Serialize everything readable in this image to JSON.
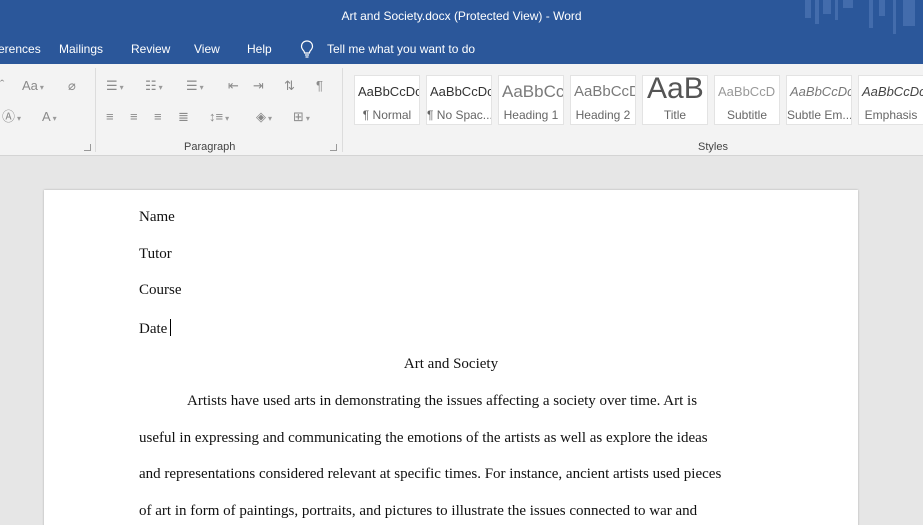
{
  "titlebar": {
    "title": "Art and Society.docx (Protected View)  -  Word"
  },
  "menu": {
    "items": [
      "erences",
      "Mailings",
      "Review",
      "View",
      "Help"
    ],
    "tell_me": "Tell me what you want to do"
  },
  "ribbon": {
    "groups": {
      "paragraph": "Paragraph",
      "styles": "Styles"
    },
    "font_icons": {
      "size_case": "Aa",
      "font_color": "A"
    },
    "styles": [
      {
        "preview": "AaBbCcDc",
        "name": "¶ Normal"
      },
      {
        "preview": "AaBbCcDc",
        "name": "¶ No Spac..."
      },
      {
        "preview": "AaBbCc",
        "name": "Heading 1"
      },
      {
        "preview": "AaBbCcD",
        "name": "Heading 2"
      },
      {
        "preview": "AaB",
        "name": "Title"
      },
      {
        "preview": "AaBbCcD",
        "name": "Subtitle"
      },
      {
        "preview": "AaBbCcDc",
        "name": "Subtle Em..."
      },
      {
        "preview": "AaBbCcDc",
        "name": "Emphasis"
      }
    ]
  },
  "document": {
    "header_lines": [
      "Name",
      "Tutor",
      "Course",
      "Date"
    ],
    "heading": "Art and Society",
    "body_lines": [
      "Artists have used arts in demonstrating the issues affecting a society over time. Art is",
      "useful in expressing and communicating the emotions of the artists as well as explore the ideas",
      "and representations considered relevant at specific times. For instance, ancient artists used pieces",
      "of art in form of paintings, portraits, and pictures to illustrate the issues connected to war and"
    ]
  }
}
